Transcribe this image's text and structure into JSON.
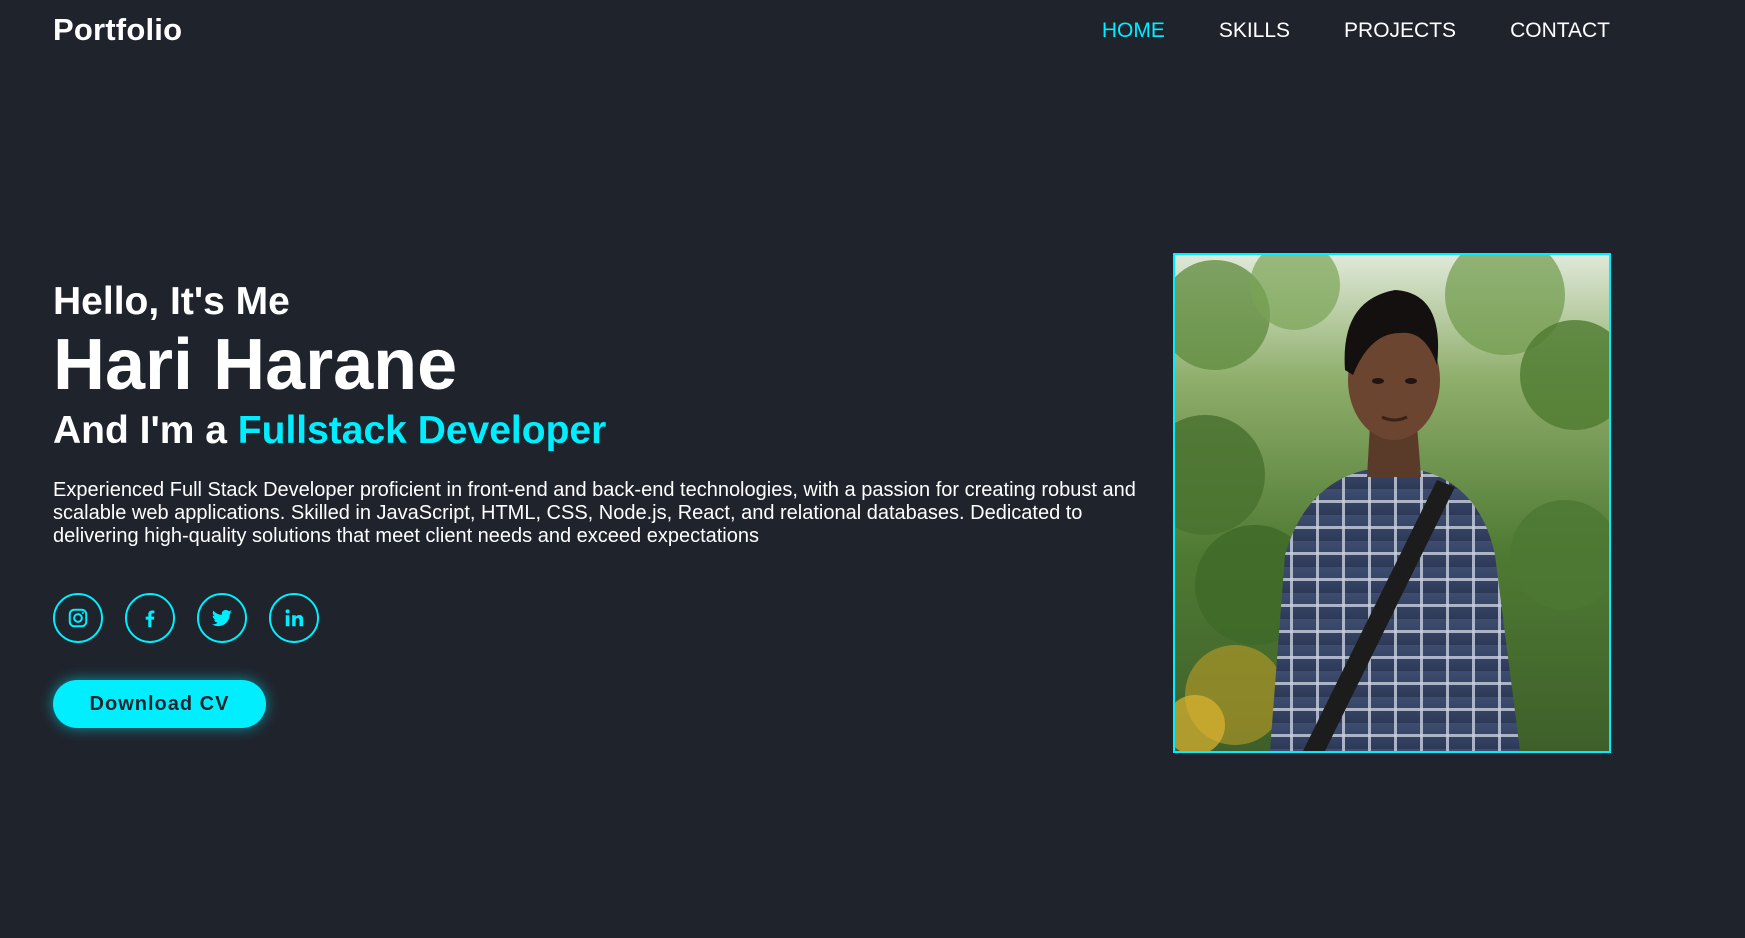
{
  "header": {
    "logo": "Portfolio",
    "nav": [
      {
        "label": "HOME",
        "active": true
      },
      {
        "label": "SKILLS",
        "active": false
      },
      {
        "label": "PROJECTS",
        "active": false
      },
      {
        "label": "CONTACT",
        "active": false
      }
    ]
  },
  "hero": {
    "greeting": "Hello, It's Me",
    "name": "Hari Harane",
    "role_prefix": "And I'm a ",
    "role_highlight": "Fullstack Developer",
    "bio": "Experienced Full Stack Developer proficient in front-end and back-end technologies, with a passion for creating robust and scalable web applications. Skilled in JavaScript, HTML, CSS, Node.js, React, and relational databases. Dedicated to delivering high-quality solutions that meet client needs and exceed expectations",
    "socials": [
      {
        "icon": "instagram-icon"
      },
      {
        "icon": "facebook-icon"
      },
      {
        "icon": "twitter-icon"
      },
      {
        "icon": "linkedin-icon"
      }
    ],
    "cta_label": "Download CV"
  },
  "colors": {
    "background": "#1f232c",
    "accent": "#00eeff",
    "text": "#ffffff"
  }
}
